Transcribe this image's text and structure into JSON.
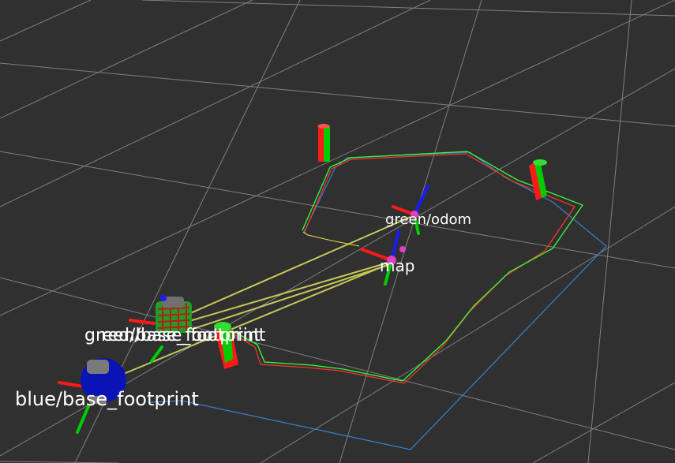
{
  "viewport": {
    "background": "#303030",
    "grid_color": "#9a9a9a",
    "frame_labels": {
      "green_odom": "green/odom",
      "map": "map",
      "green_base_footprint": "green/base_footprint",
      "red_base_footprint": "red/base_footprint",
      "blue_base_footprint": "blue/base_footprint"
    },
    "colors": {
      "axis_x": "#ff1a1a",
      "axis_y": "#00cc00",
      "axis_z": "#1a1aff",
      "tf_link": "#d8d860",
      "path_green": "#33ff33",
      "path_red": "#ff3333",
      "path_yellow": "#e0e040",
      "path_blue": "#3a7fd0",
      "robot_green": "#1f9d2a",
      "robot_blue": "#0a14b4",
      "marker_magenta": "#e040c0"
    }
  }
}
